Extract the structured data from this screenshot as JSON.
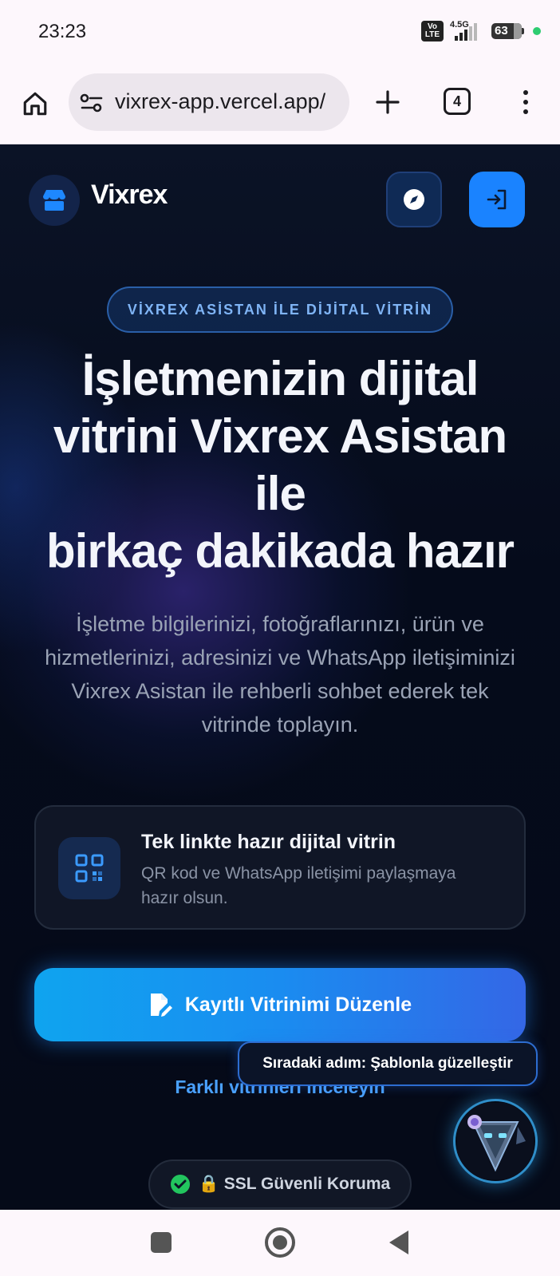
{
  "status_bar": {
    "time": "23:23",
    "volte": "Vo LTE",
    "network": "4.5G",
    "battery": "63"
  },
  "browser": {
    "url": "vixrex-app.vercel.app/",
    "tab_count": "4"
  },
  "header": {
    "brand": "Vixrex"
  },
  "hero": {
    "badge": "VİXREX ASİSTAN İLE DİJİTAL VİTRİN",
    "title_line1": "İşletmenizin dijital",
    "title_line2": "vitrini Vixrex Asistan",
    "title_line3": "ile",
    "title_line4": "birkaç dakikada hazır",
    "subtitle": "İşletme bilgilerinizi, fotoğraflarınızı, ürün ve hizmetlerinizi, adresinizi ve WhatsApp iletişiminizi Vixrex Asistan ile rehberli sohbet ederek tek vitrinde toplayın."
  },
  "feature": {
    "title": "Tek linkte hazır dijital vitrin",
    "description": "QR kod ve WhatsApp iletişimi paylaşmaya hazır olsun."
  },
  "cta": {
    "label": "Kayıtlı Vitrinimi Düzenle"
  },
  "browse_link": "Farklı vitrinleri inceleyin",
  "tooltip": "Sıradaki adım: Şablonla güzelleştir",
  "ssl_badge": "🔒 SSL Güvenli Koruma",
  "colors": {
    "accent": "#1a83ff",
    "background": "#050b1b",
    "link": "#4aa1ff",
    "success": "#22c55e"
  }
}
